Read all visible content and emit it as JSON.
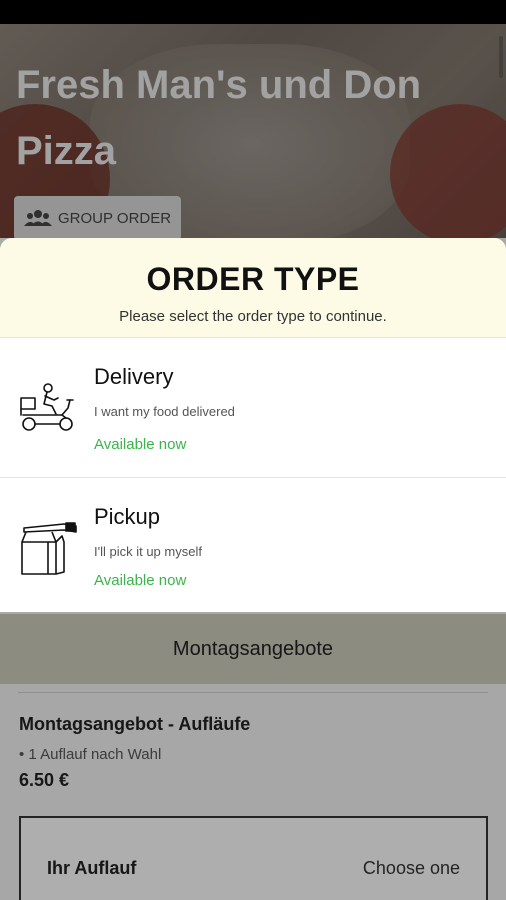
{
  "restaurant": {
    "name": "Fresh Man's und Don Pizza",
    "group_order_label": "GROUP ORDER"
  },
  "menu": {
    "section_title": "Montagsangebote",
    "deal": {
      "title": "Montagsangebot - Aufläufe",
      "description": "• 1 Auflauf nach Wahl",
      "price": "6.50 €",
      "choice_label": "Ihr Auflauf",
      "choice_value": "Choose one"
    }
  },
  "order_type_modal": {
    "title": "ORDER TYPE",
    "subtitle": "Please select the order type to continue.",
    "options": [
      {
        "name": "Delivery",
        "description": "I want my food delivered",
        "availability": "Available now",
        "icon": "scooter-delivery-icon"
      },
      {
        "name": "Pickup",
        "description": "I'll pick it up myself",
        "availability": "Available now",
        "icon": "takeaway-bag-icon"
      }
    ]
  },
  "colors": {
    "available_green": "#3cb44b",
    "modal_header_bg": "#fdfbe6",
    "section_bar_bg": "#c9c9b9"
  }
}
